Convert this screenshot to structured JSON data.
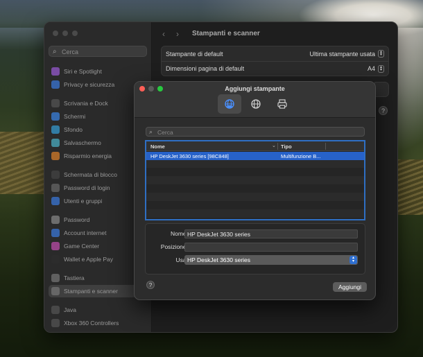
{
  "sidebar": {
    "search_placeholder": "Cerca",
    "items": [
      {
        "label": "Siri e Spotlight",
        "icon": "siri-icon",
        "color": "#9c5bd9"
      },
      {
        "label": "Privacy e sicurezza",
        "icon": "hand-icon",
        "color": "#3a7be0"
      },
      {
        "label": "Scrivania e Dock",
        "icon": "dock-icon",
        "color": "#555555"
      },
      {
        "label": "Schermi",
        "icon": "display-icon",
        "color": "#3a86e8"
      },
      {
        "label": "Sfondo",
        "icon": "wallpaper-icon",
        "color": "#36a0d8"
      },
      {
        "label": "Salvaschermo",
        "icon": "screensaver-icon",
        "color": "#4bb3c9"
      },
      {
        "label": "Risparmio energia",
        "icon": "battery-icon",
        "color": "#e0822a"
      },
      {
        "label": "Schermata di blocco",
        "icon": "lock-screen-icon",
        "color": "#444444"
      },
      {
        "label": "Password di login",
        "icon": "login-password-icon",
        "color": "#6a6a6a"
      },
      {
        "label": "Utenti e gruppi",
        "icon": "users-icon",
        "color": "#3a7be0"
      },
      {
        "label": "Password",
        "icon": "key-icon",
        "color": "#8a8a8a"
      },
      {
        "label": "Account internet",
        "icon": "at-icon",
        "color": "#3a7be0"
      },
      {
        "label": "Game Center",
        "icon": "game-center-icon",
        "color": "#c44fb0"
      },
      {
        "label": "Wallet e Apple Pay",
        "icon": "wallet-icon",
        "color": "#2d2d2d"
      },
      {
        "label": "Tastiera",
        "icon": "keyboard-icon",
        "color": "#777777"
      },
      {
        "label": "Stampanti e scanner",
        "icon": "printer-icon",
        "color": "#777777"
      },
      {
        "label": "Java",
        "icon": "java-icon",
        "color": "#555555"
      },
      {
        "label": "Xbox 360 Controllers",
        "icon": "gamepad-icon",
        "color": "#555555"
      }
    ]
  },
  "main": {
    "title": "Stampanti e scanner",
    "rows": [
      {
        "label": "Stampante di default",
        "value": "Ultima stampante usata"
      },
      {
        "label": "Dimensioni pagina di default",
        "value": "A4"
      }
    ]
  },
  "dialog": {
    "title": "Aggiungi stampante",
    "tabs": [
      "default-printers-tab",
      "ip-printer-tab",
      "windows-printer-tab"
    ],
    "search_placeholder": "Cerca",
    "table": {
      "col_name": "Nome",
      "col_kind": "Tipo",
      "rows": [
        {
          "name": "HP DeskJet 3630 series [98C848]",
          "kind": "Multifunzione B..."
        }
      ]
    },
    "form": {
      "name_label": "Nome:",
      "name_value": "HP DeskJet 3630 series",
      "location_label": "Posizione:",
      "location_value": "",
      "use_label": "Usa:",
      "use_value": "HP DeskJet 3630 series"
    },
    "add_button": "Aggiungi",
    "colors": {
      "accent": "#2762c9",
      "close": "#ff5f57",
      "minimize": "#febc2e",
      "zoom": "#28c840"
    }
  }
}
